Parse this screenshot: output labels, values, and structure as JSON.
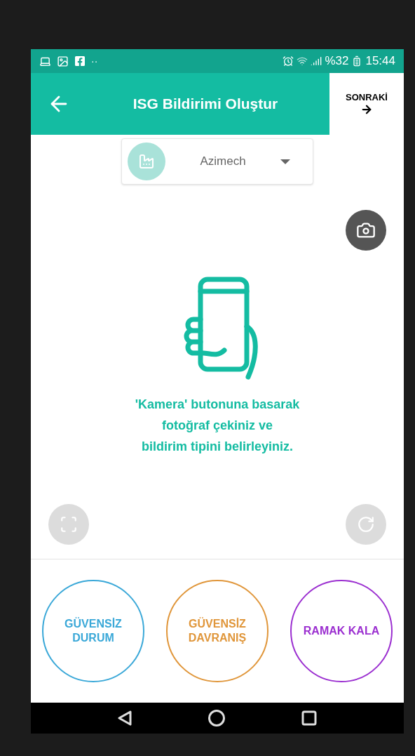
{
  "status_bar": {
    "dots": "··",
    "battery": "%32",
    "time": "15:44"
  },
  "header": {
    "title": "ISG Bildirimi Oluştur",
    "next": "SONRAKİ"
  },
  "company_select": {
    "value": "Azimech"
  },
  "hint": "'Kamera' butonuna basarak\nfotoğraf çekiniz ve\nbildirim tipini belirleyiniz.",
  "report_types": [
    {
      "label": "GÜVENSİZ DURUM",
      "color": "#3aa8d8"
    },
    {
      "label": "GÜVENSİZ DAVRANIŞ",
      "color": "#e0963a"
    },
    {
      "label": "RAMAK KALA",
      "color": "#9b2fd0"
    }
  ]
}
